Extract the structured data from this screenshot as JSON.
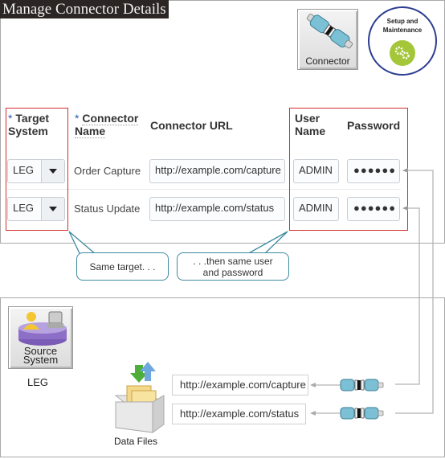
{
  "title": "Manage Connector Details",
  "top_icons": {
    "connector_label": "Connector",
    "setup_label_line1": "Setup and",
    "setup_label_line2": "Maintenance"
  },
  "table": {
    "required_marker": "*",
    "headers": {
      "target_system_line1": "Target",
      "target_system_line2": "System",
      "connector_name_line1": "Connector",
      "connector_name_line2": "Name",
      "connector_url": "Connector URL",
      "user_name_line1": "User",
      "user_name_line2": "Name",
      "password": "Password"
    },
    "rows": [
      {
        "target_system": "LEG",
        "connector_name": "Order Capture",
        "connector_url": "http://example.com/capture",
        "user_name": "ADMIN",
        "password": "●●●●●●"
      },
      {
        "target_system": "LEG",
        "connector_name": "Status Update",
        "connector_url": "http://example.com/status",
        "user_name": "ADMIN",
        "password": "●●●●●●"
      }
    ]
  },
  "callouts": {
    "same_target": "Same target. . .",
    "same_user_line1": ". . .then same user",
    "same_user_line2": "and password"
  },
  "source_system": {
    "icon_line1": "Source",
    "icon_line2": "System",
    "name": "LEG"
  },
  "data_files": {
    "label": "Data Files",
    "urls": [
      "http://example.com/capture",
      "http://example.com/status"
    ]
  },
  "colors": {
    "highlight_border": "#d32f2f",
    "callout_border": "#3e8aa0",
    "connector_line": "#b5b5b5",
    "setup_circle_border": "#2c3e8f",
    "setup_green": "#a4c639"
  }
}
